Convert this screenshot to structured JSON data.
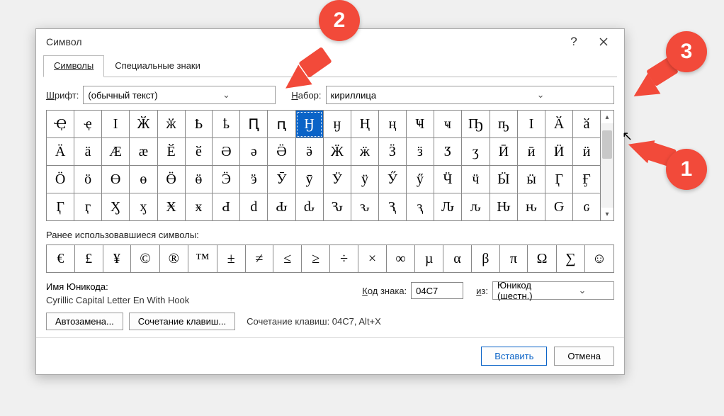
{
  "title": "Символ",
  "tabs": {
    "symbols": "Символы",
    "special": "Специальные знаки"
  },
  "font": {
    "label_pre": "Ш",
    "label_post": "рифт:",
    "value": "(обычный текст)"
  },
  "subset": {
    "label_pre": "Н",
    "label_post": "абор:",
    "value": "кириллица"
  },
  "grid": [
    [
      "Ҿ",
      "ҿ",
      "І",
      "Ӂ",
      "ӂ",
      "Ҍ",
      "ҍ",
      "Ԥ",
      "ԥ",
      "Ӈ",
      "ӈ",
      "Ң",
      "ң",
      "Ҹ",
      "ҹ",
      "Ҧ",
      "ҧ",
      "Ӏ",
      "Ӑ",
      "ӑ"
    ],
    [
      "Ӓ",
      "ӓ",
      "Ӕ",
      "ӕ",
      "Ӗ",
      "ӗ",
      "Ә",
      "ә",
      "Ӛ",
      "ӛ",
      "Ӝ",
      "ӝ",
      "Ӟ",
      "ӟ",
      "Ӡ",
      "ӡ",
      "Ӣ",
      "ӣ",
      "Ӥ",
      "ӥ"
    ],
    [
      "Ӧ",
      "ӧ",
      "Ө",
      "ө",
      "Ӫ",
      "ӫ",
      "Ӭ",
      "ӭ",
      "Ӯ",
      "ӯ",
      "Ӱ",
      "ӱ",
      "Ӳ",
      "ӳ",
      "Ӵ",
      "ӵ",
      "Ӹ",
      "ӹ",
      "Ӷ",
      "Ӻ"
    ],
    [
      "Ӷ",
      "ӷ",
      "Ӽ",
      "ӽ",
      "Ӿ",
      "ӿ",
      "Ԁ",
      "ԁ",
      "Ԃ",
      "ԃ",
      "Ԅ",
      "ԅ",
      "Ԇ",
      "ԇ",
      "Ԉ",
      "ԉ",
      "Ԋ",
      "ԋ",
      "Ԍ",
      "ԍ"
    ]
  ],
  "selected": {
    "row": 0,
    "col": 9
  },
  "recent_label": "Ранее использовавшиеся символы:",
  "recent": [
    "€",
    "£",
    "¥",
    "©",
    "®",
    "™",
    "±",
    "≠",
    "≤",
    "≥",
    "÷",
    "×",
    "∞",
    "µ",
    "α",
    "β",
    "π",
    "Ω",
    "∑",
    "☺"
  ],
  "unicode": {
    "label": "Имя Юникода:",
    "name": "Cyrillic Capital Letter En With Hook"
  },
  "code": {
    "label_pre": "К",
    "label_post": "од знака:",
    "value": "04C7"
  },
  "from": {
    "label_pre": "и",
    "label_post": "з:",
    "value": "Юникод (шестн.)"
  },
  "autocorrect_btn": "Автозамена...",
  "shortcut_btn": "Сочетание клавиш...",
  "shortcut_text": "Сочетание клавиш: 04C7, Alt+X",
  "insert_btn": "Вставить",
  "cancel_btn": "Отмена",
  "badges": {
    "b1": "1",
    "b2": "2",
    "b3": "3"
  }
}
